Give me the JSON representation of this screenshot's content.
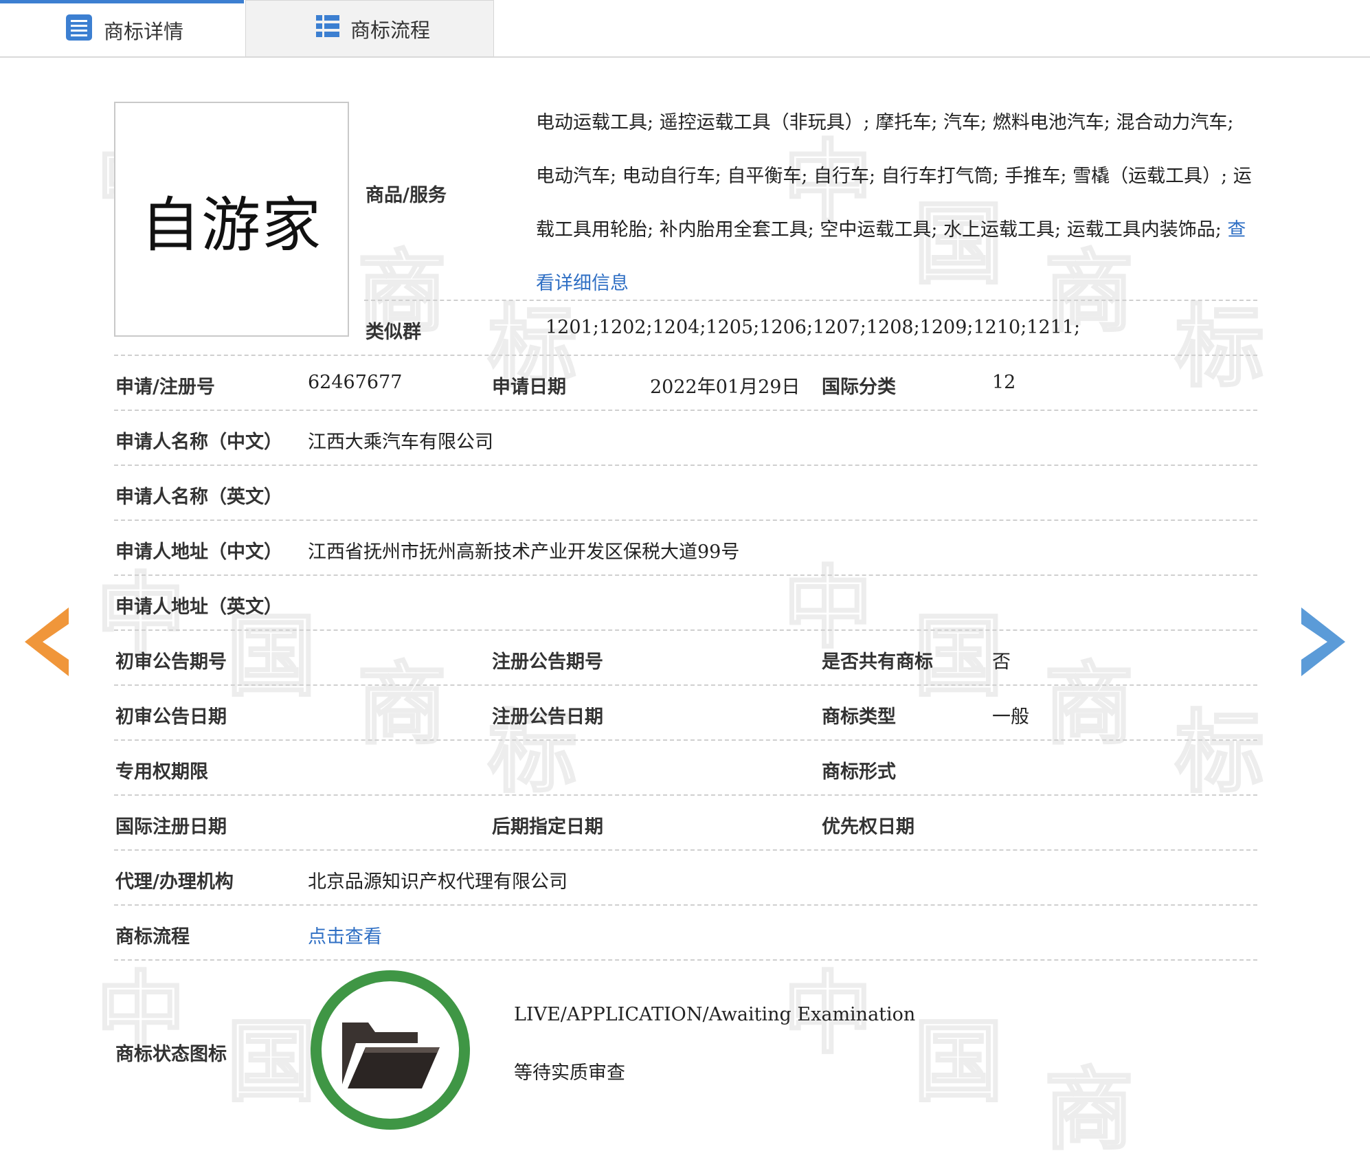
{
  "tabs": [
    {
      "label": "商标详情",
      "icon": "document-list-icon",
      "active": true
    },
    {
      "label": "商标流程",
      "icon": "list-icon",
      "active": false
    }
  ],
  "trademark": {
    "logo_text": "自游家"
  },
  "goods_services": {
    "label": "商品/服务",
    "text": "电动运载工具; 遥控运载工具（非玩具）; 摩托车; 汽车; 燃料电池汽车; 混合动力汽车; 电动汽车; 电动自行车; 自平衡车; 自行车; 自行车打气筒; 手推车; 雪橇（运载工具）; 运载工具用轮胎; 补内胎用全套工具; 空中运载工具; 水上运载工具; 运载工具内装饰品; ",
    "detail_link": "查看详细信息"
  },
  "similar_group": {
    "label": "类似群",
    "value": "1201;1202;1204;1205;1206;1207;1208;1209;1210;1211;"
  },
  "fields": {
    "reg_no_label": "申请/注册号",
    "reg_no": "62467677",
    "apply_date_label": "申请日期",
    "apply_date": "2022年01月29日",
    "intl_class_label": "国际分类",
    "intl_class": "12",
    "applicant_cn_label": "申请人名称（中文）",
    "applicant_cn": "江西大乘汽车有限公司",
    "applicant_en_label": "申请人名称（英文）",
    "applicant_en": "",
    "address_cn_label": "申请人地址（中文）",
    "address_cn": "江西省抚州市抚州高新技术产业开发区保税大道99号",
    "address_en_label": "申请人地址（英文）",
    "address_en": "",
    "prelim_issue_label": "初审公告期号",
    "prelim_issue": "",
    "reg_issue_label": "注册公告期号",
    "reg_issue": "",
    "shared_label": "是否共有商标",
    "shared": "否",
    "prelim_date_label": "初审公告日期",
    "prelim_date": "",
    "reg_date_label": "注册公告日期",
    "reg_date": "",
    "type_label": "商标类型",
    "type": "一般",
    "exclusive_label": "专用权期限",
    "exclusive": "",
    "form_label": "商标形式",
    "form": "",
    "intl_reg_date_label": "国际注册日期",
    "intl_reg_date": "",
    "later_date_label": "后期指定日期",
    "later_date": "",
    "priority_label": "优先权日期",
    "priority": "",
    "agent_label": "代理/办理机构",
    "agent": "北京品源知识产权代理有限公司",
    "flow_label": "商标流程",
    "flow_link": "点击查看",
    "status_label": "商标状态图标",
    "status_en": "LIVE/APPLICATION/Awaiting Examination",
    "status_cn": "等待实质审查"
  },
  "nav": {
    "prev_icon": "arrow-left-icon",
    "next_icon": "arrow-right-icon"
  },
  "colors": {
    "tab_accent": "#3c7fd1",
    "link": "#2f6fc4",
    "status_ring": "#3f9645",
    "prev_arrow": "#f0963a",
    "next_arrow": "#5b9bd8"
  }
}
